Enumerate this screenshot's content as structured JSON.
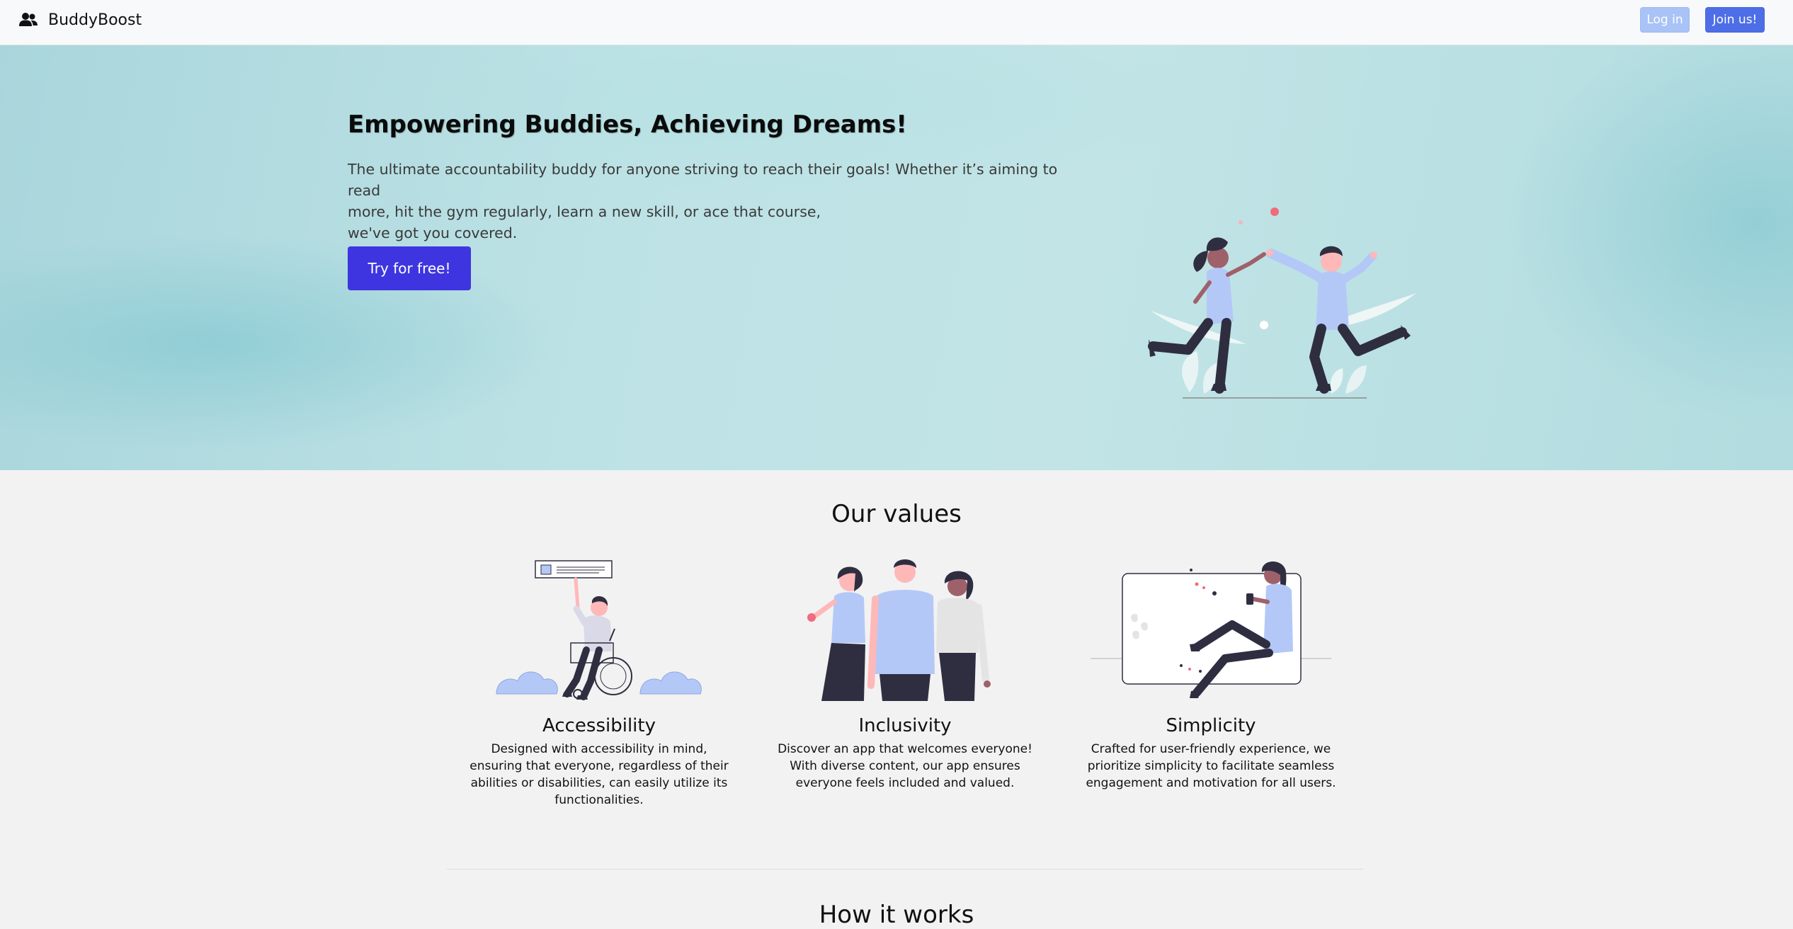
{
  "navbar": {
    "brand": "BuddyBoost",
    "brand_icon": "users-icon",
    "login_label": "Log in",
    "join_label": "Join us!"
  },
  "hero": {
    "title": "Empowering Buddies, Achieving Dreams!",
    "text_lines": [
      "The ultimate accountability buddy for anyone striving to reach their goals! Whether it’s aiming to read",
      "more, hit the gym regularly, learn a new skill, or ace that course,",
      "we've got you covered."
    ],
    "cta_label": "Try for free!"
  },
  "values": {
    "title": "Our values",
    "items": [
      {
        "title": "Accessibility",
        "text": "Designed with accessibility in mind, ensuring that everyone, regardless of their abilities or disabilities, can easily utilize its functionalities."
      },
      {
        "title": "Inclusivity",
        "text": "Discover an app that welcomes everyone! With diverse content, our app ensures everyone feels included and valued."
      },
      {
        "title": "Simplicity",
        "text": "Crafted for user-friendly experience, we prioritize simplicity to facilitate seamless engagement and motivation for all users."
      }
    ]
  },
  "how_it_works": {
    "title": "How it works"
  },
  "colors": {
    "accent": "#3f35e0",
    "join_button": "#4d6ee6",
    "login_button": "#a9c3f7",
    "illustration_blue": "#b4c8f8",
    "illustration_dark": "#2f2e41",
    "illustration_pink": "#f06b7c"
  }
}
